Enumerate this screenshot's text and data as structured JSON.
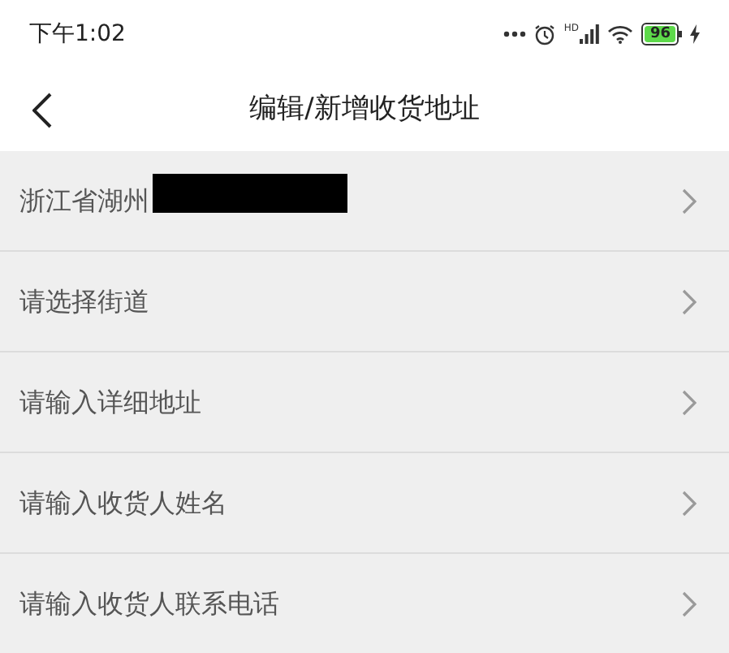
{
  "status_bar": {
    "time": "下午1:02",
    "network_label": "HD",
    "battery": "96"
  },
  "header": {
    "title": "编辑/新增收货地址"
  },
  "rows": [
    {
      "text": "浙江省湖州",
      "redacted": true
    },
    {
      "text": "请选择街道",
      "redacted": false
    },
    {
      "text": "请输入详细地址",
      "redacted": false
    },
    {
      "text": "请输入收货人姓名",
      "redacted": false
    },
    {
      "text": "请输入收货人联系电话",
      "redacted": false
    }
  ]
}
